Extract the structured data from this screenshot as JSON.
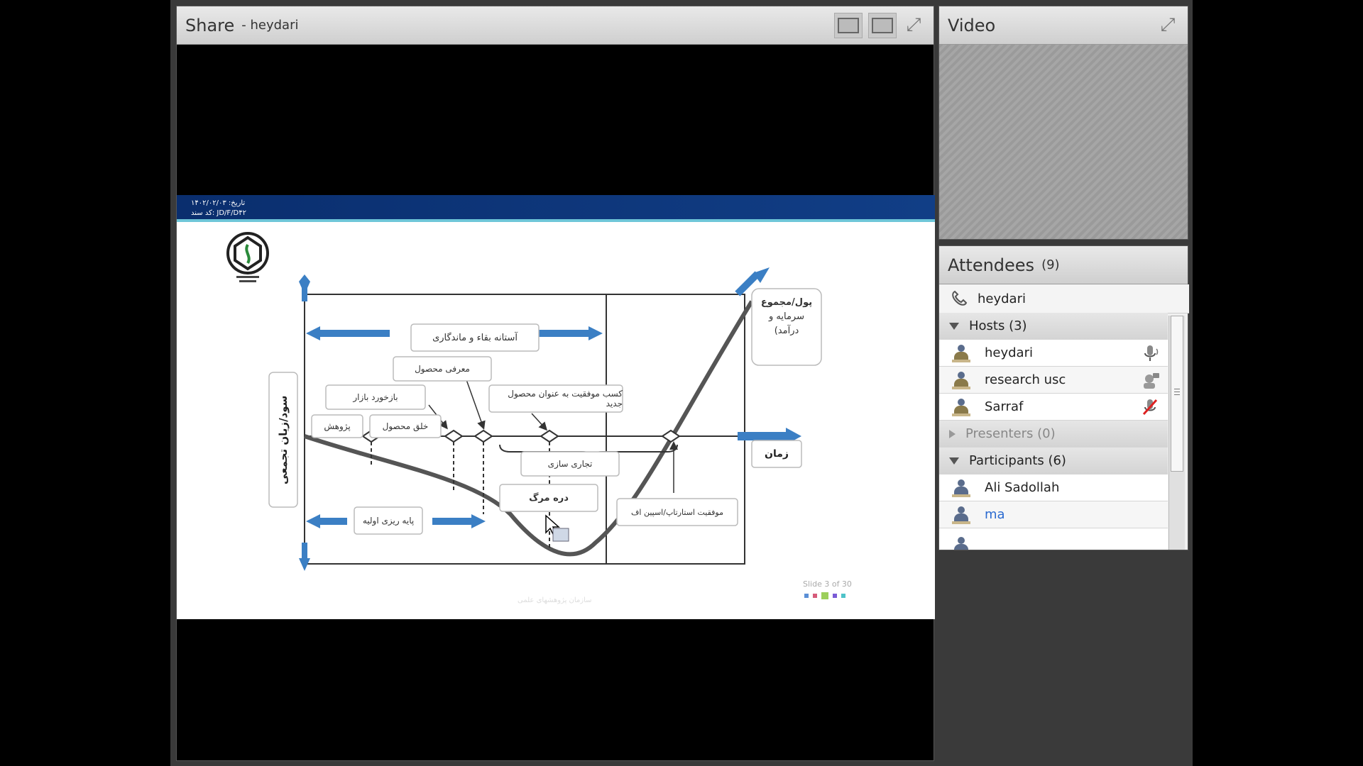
{
  "share": {
    "title": "Share",
    "presenter": "- heydari"
  },
  "video": {
    "title": "Video"
  },
  "attendees": {
    "title": "Attendees",
    "count": "(9)",
    "me": "heydari",
    "groups": {
      "hosts": {
        "label": "Hosts (3)",
        "members": [
          "heydari",
          "research usc",
          "Sarraf"
        ]
      },
      "presenters": {
        "label": "Presenters (0)"
      },
      "participants": {
        "label": "Participants (6)",
        "members": [
          "Ali Sadollah",
          "ma"
        ]
      }
    }
  },
  "slide": {
    "header_line1": "تاریخ: ۱۴۰۲/۰۲/۰۳",
    "header_line2": "کد سند: JD/F/D۴۲",
    "y_axis_label": "سود/زیان تجمعی",
    "x_axis_label": "زمان",
    "money_label": [
      "پول/مجموع",
      "سرمایه و",
      "درآمد)"
    ],
    "boxes": {
      "threshold": "آستانه بقاء و ماندگاری",
      "product_intro": "معرفی محصول",
      "market_feedback": "بازخورد بازار",
      "research": "پژوهش",
      "product_creation": "خلق محصول",
      "new_product_success": "کسب موفقیت به عنوان محصول جدید",
      "commercialization": "تجاری سازی",
      "death_valley": "دره مرگ",
      "startup_success": "موفقیت استارتاپ/اسپین اف",
      "seed": "پایه ریزی اولیه"
    },
    "slide_number": "Slide 3 of 30",
    "footer": "سازمان پژوهشهای علمی"
  },
  "colors": {
    "arrow_blue": "#3b7fc4",
    "band": "#0a2e6e",
    "band_line": "#6ec6d8"
  }
}
